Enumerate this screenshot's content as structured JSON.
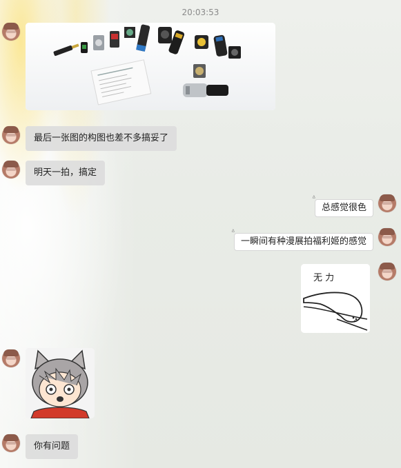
{
  "chat": {
    "timestamp": "20:03:53",
    "messages": [
      {
        "side": "left",
        "type": "image",
        "image_desc": "connectors-product-photo"
      },
      {
        "side": "left",
        "type": "text",
        "text": "最后一张图的构图也差不多搞妥了"
      },
      {
        "side": "left",
        "type": "text",
        "text": "明天一拍，搞定"
      },
      {
        "side": "right",
        "type": "text",
        "text": "总感觉很色"
      },
      {
        "side": "right",
        "type": "text",
        "text": "一瞬间有种漫展拍福利姬的感觉"
      },
      {
        "side": "right",
        "type": "sticker",
        "image_desc": "lying-cat-sticker",
        "sticker_text": "无 力"
      },
      {
        "side": "left",
        "type": "sticker",
        "image_desc": "catgirl-shocked-sticker"
      },
      {
        "side": "left",
        "type": "text",
        "text": "你有问题"
      }
    ]
  }
}
